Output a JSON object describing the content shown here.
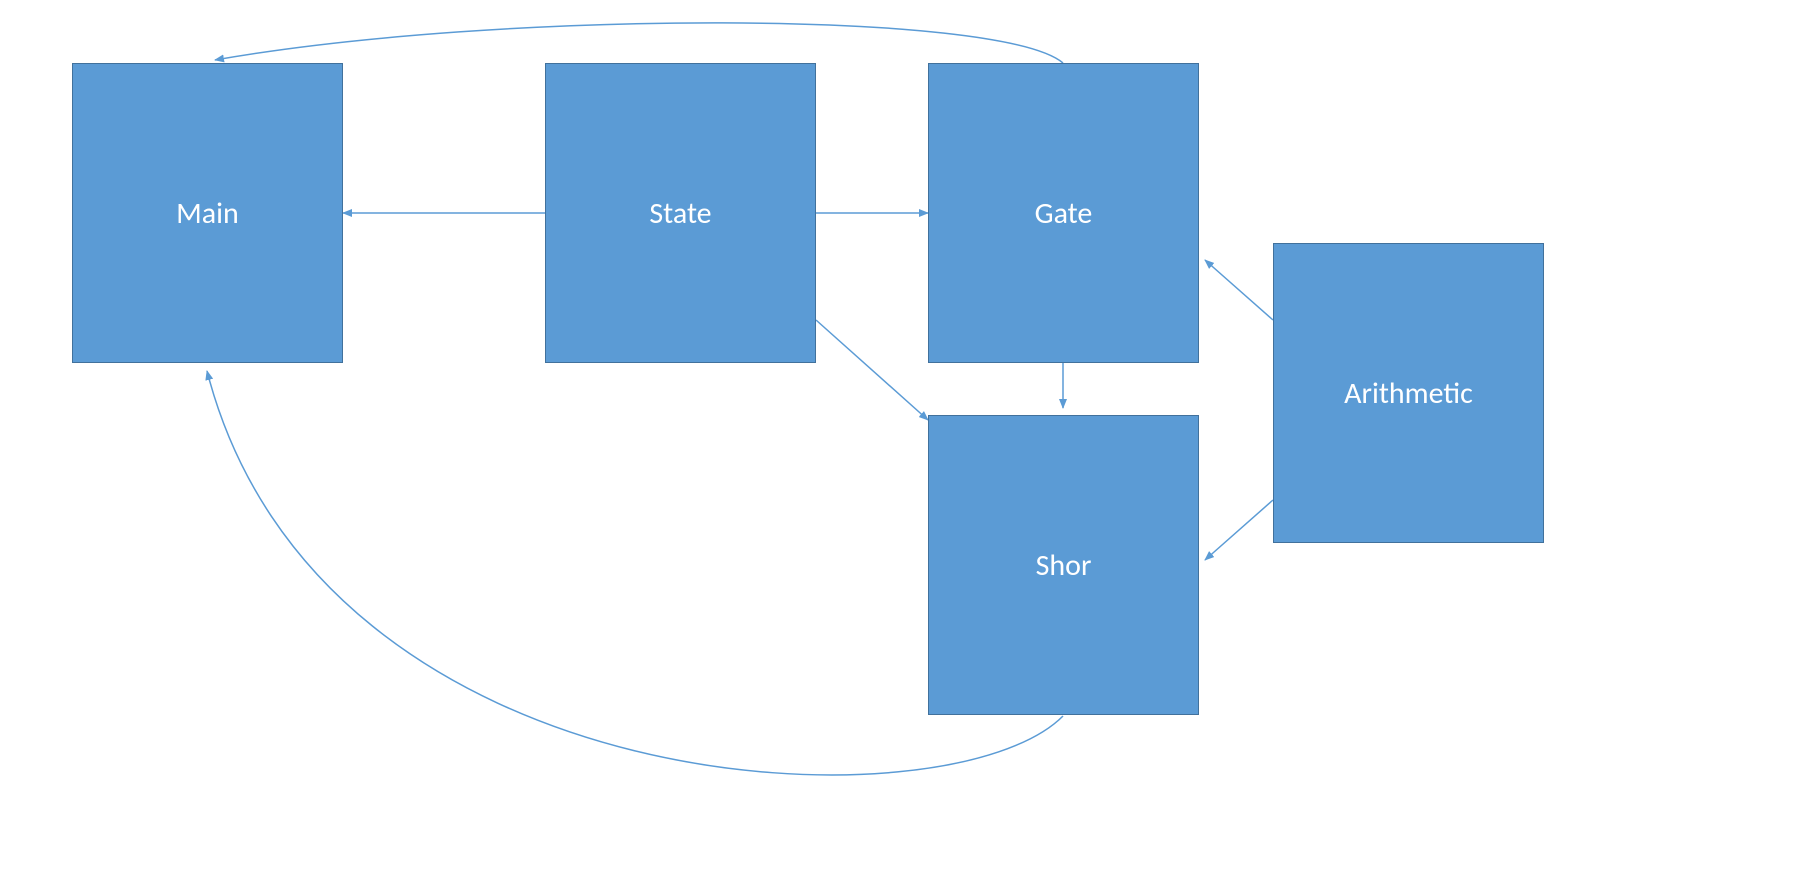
{
  "nodes": {
    "main": {
      "label": "Main"
    },
    "state": {
      "label": "State"
    },
    "gate": {
      "label": "Gate"
    },
    "shor": {
      "label": "Shor"
    },
    "arithmetic": {
      "label": "Arithmetic"
    }
  },
  "colors": {
    "fill": "#5B9BD5",
    "border": "#41719C",
    "arrow": "#5B9BD5"
  }
}
